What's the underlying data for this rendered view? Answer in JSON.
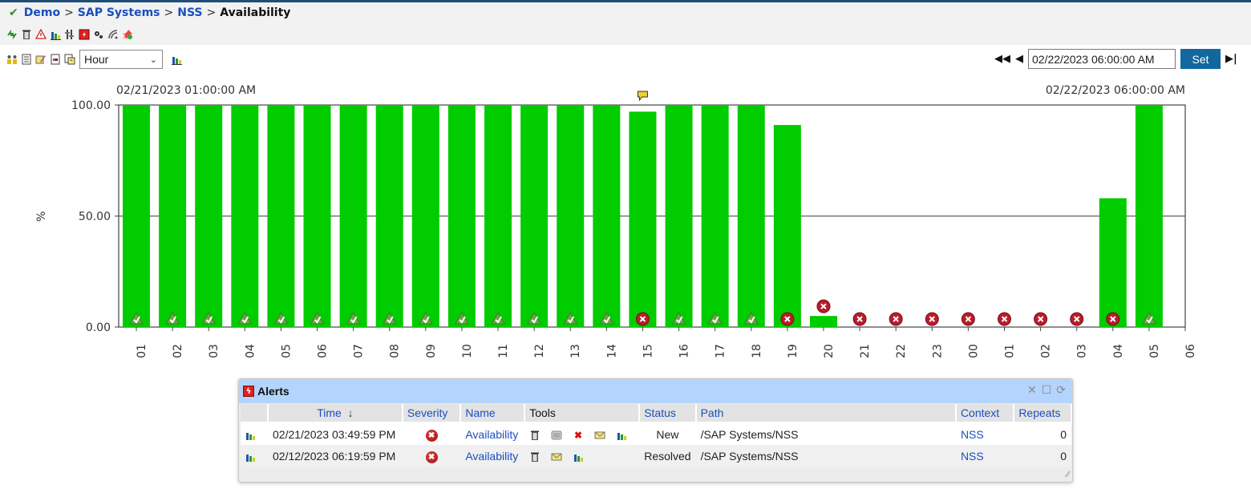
{
  "breadcrumb": {
    "items": [
      "Demo",
      "SAP Systems",
      "NSS"
    ],
    "current": "Availability",
    "separator": ">"
  },
  "toolbar1": {
    "icons": [
      "refresh-icon",
      "trash-icon",
      "alert-settings-icon",
      "chart-icon",
      "tools-icon",
      "alert-red-icon",
      "gears-icon",
      "signal-icon",
      "pin-icon"
    ]
  },
  "toolbar2": {
    "icons": [
      "group-icon",
      "document-icon",
      "edit-icon",
      "report-icon",
      "export-icon"
    ],
    "interval_select": "Hour",
    "chart_icon": "chart-icon"
  },
  "navigation": {
    "date_value": "02/22/2023 06:00:00 AM",
    "set_label": "Set"
  },
  "chart_data": {
    "type": "bar",
    "start_label": "02/21/2023 01:00:00 AM",
    "end_label": "02/22/2023 06:00:00 AM",
    "ylabel": "%",
    "ylim": [
      0,
      100
    ],
    "yticks": [
      "0.00",
      "50.00",
      "100.00"
    ],
    "grid": true,
    "bar_color": "#00cc00",
    "categories": [
      "01",
      "02",
      "03",
      "04",
      "05",
      "06",
      "07",
      "08",
      "09",
      "10",
      "11",
      "12",
      "13",
      "14",
      "15",
      "16",
      "17",
      "18",
      "19",
      "20",
      "21",
      "22",
      "23",
      "00",
      "01",
      "02",
      "03",
      "04",
      "05"
    ],
    "xtick_labels": [
      "01",
      "02",
      "03",
      "04",
      "05",
      "06",
      "07",
      "08",
      "09",
      "10",
      "11",
      "12",
      "13",
      "14",
      "15",
      "16",
      "17",
      "18",
      "19",
      "20",
      "21",
      "22",
      "23",
      "00",
      "01",
      "02",
      "03",
      "04",
      "05",
      "06"
    ],
    "values": [
      100,
      100,
      100,
      100,
      100,
      100,
      100,
      100,
      100,
      100,
      100,
      100,
      100,
      100,
      97,
      100,
      100,
      100,
      91,
      5,
      0,
      0,
      0,
      0,
      0,
      0,
      0,
      58,
      100
    ],
    "status": [
      "ok",
      "ok",
      "ok",
      "ok",
      "ok",
      "ok",
      "ok",
      "ok",
      "ok",
      "ok",
      "ok",
      "ok",
      "ok",
      "ok",
      "critical",
      "ok",
      "ok",
      "ok",
      "critical",
      "critical",
      "critical",
      "critical",
      "critical",
      "critical",
      "critical",
      "critical",
      "critical",
      "critical",
      "ok"
    ],
    "annotations": [
      {
        "category_index": 14,
        "type": "note-icon"
      }
    ]
  },
  "alerts": {
    "title": "Alerts",
    "columns": [
      "",
      "Time",
      "Severity",
      "Name",
      "Tools",
      "Status",
      "Path",
      "Context",
      "Repeats"
    ],
    "sort_indicator": "↓",
    "rows": [
      {
        "time": "02/21/2023 03:49:59 PM",
        "severity": "critical",
        "name": "Availability",
        "tools": [
          "trash-icon",
          "list-icon",
          "close-x-icon",
          "mail-icon",
          "chart-icon"
        ],
        "status": "New",
        "path": "/SAP Systems/NSS",
        "context": "NSS",
        "repeats": "0"
      },
      {
        "time": "02/12/2023 06:19:59 PM",
        "severity": "critical",
        "name": "Availability",
        "tools": [
          "trash-icon",
          "mail-icon",
          "chart-icon"
        ],
        "status": "Resolved",
        "path": "/SAP Systems/NSS",
        "context": "NSS",
        "repeats": "0"
      }
    ]
  }
}
